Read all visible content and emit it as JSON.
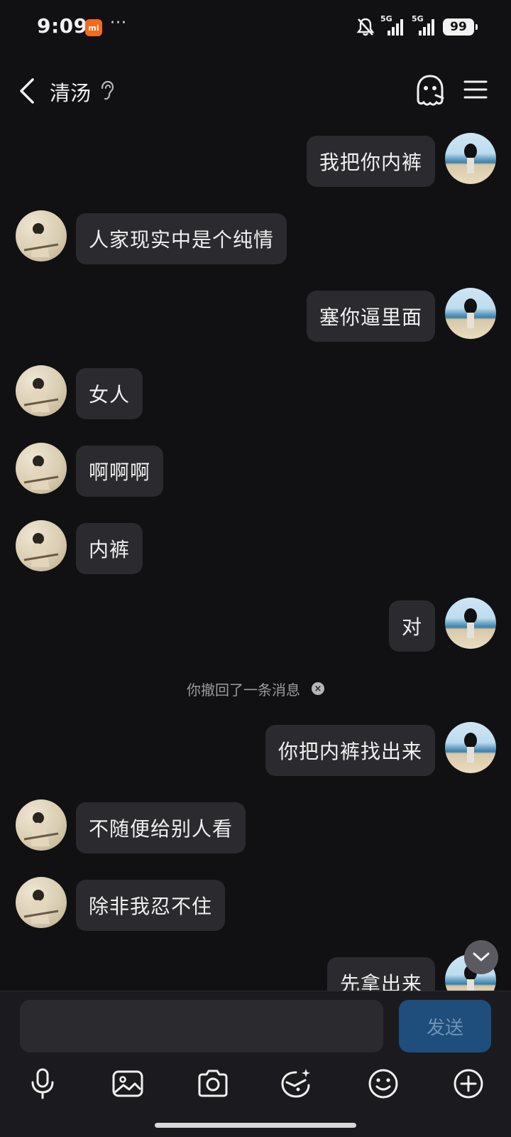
{
  "status_bar": {
    "time": "9:09",
    "brand_badge": "mi",
    "more": "···",
    "signal_1_tag": "5G",
    "signal_2_tag": "5G",
    "battery": "99"
  },
  "header": {
    "title": "清汤",
    "icons": [
      "back-icon",
      "ear-icon",
      "ghost-icon",
      "menu-icon"
    ]
  },
  "messages": [
    {
      "from": "me",
      "text": "我把你内裤"
    },
    {
      "from": "them",
      "text": "人家现实中是个纯情"
    },
    {
      "from": "me",
      "text": "塞你逼里面"
    },
    {
      "from": "them",
      "text": "女人"
    },
    {
      "from": "them",
      "text": "啊啊啊"
    },
    {
      "from": "them",
      "text": "内裤"
    },
    {
      "from": "me",
      "text": "对"
    },
    {
      "from": "me",
      "text": "你把内裤找出来"
    },
    {
      "from": "them",
      "text": "不随便给别人看"
    },
    {
      "from": "them",
      "text": "除非我忍不住"
    },
    {
      "from": "me",
      "text": "先拿出来"
    }
  ],
  "system_notice": {
    "text": "你撤回了一条消息",
    "close_glyph": "×"
  },
  "composer": {
    "input_value": "",
    "send_label": "发送"
  },
  "toolbar": [
    "microphone-icon",
    "image-icon",
    "camera-icon",
    "emoji-face-icon",
    "smile-icon",
    "plus-icon"
  ],
  "colors": {
    "background": "#111114",
    "bubble": "#2a2a2f",
    "send_button": "#1f4d7c",
    "brand_badge": "#f26a1b"
  }
}
